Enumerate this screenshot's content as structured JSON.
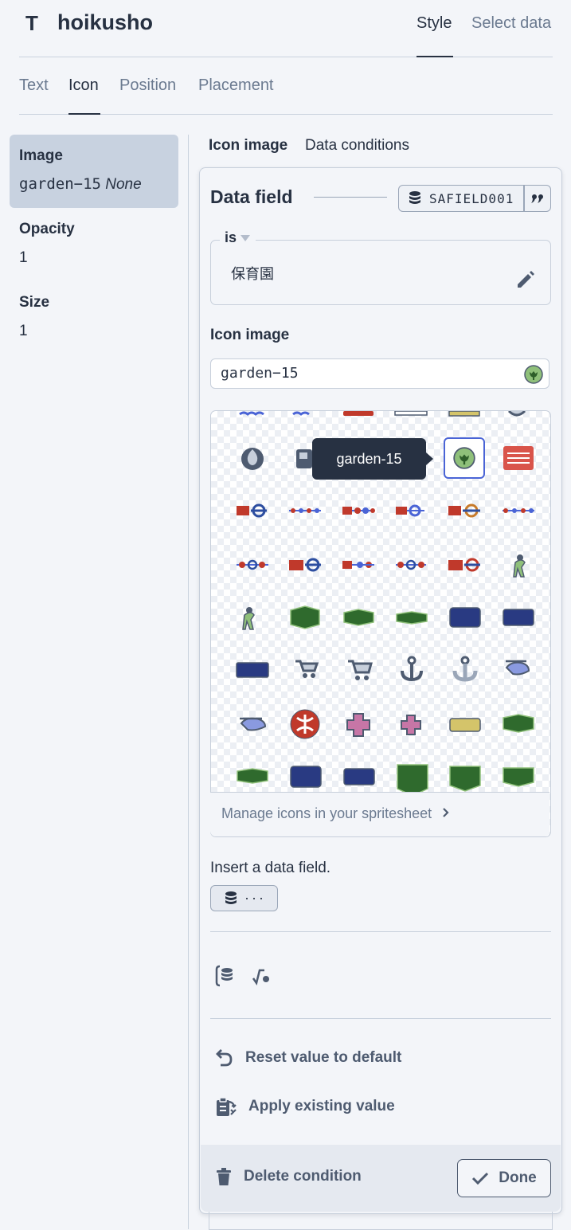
{
  "header": {
    "layer_type_icon": "text-layer-icon",
    "layer_type_glyph": "T",
    "layer_name": "hoikusho",
    "tabs": [
      {
        "label": "Style",
        "active": true
      },
      {
        "label": "Select data",
        "active": false
      }
    ]
  },
  "subtabs": [
    {
      "label": "Text",
      "active": false
    },
    {
      "label": "Icon",
      "active": true
    },
    {
      "label": "Position",
      "active": false
    },
    {
      "label": "Placement",
      "active": false
    }
  ],
  "properties": [
    {
      "label": "Image",
      "value": "garden−15",
      "value_suffix": "None",
      "selected": true
    },
    {
      "label": "Opacity",
      "value": "1"
    },
    {
      "label": "Size",
      "value": "1"
    }
  ],
  "panel_tabs": [
    {
      "label": "Icon image",
      "active": true
    },
    {
      "label": "Data conditions",
      "active": false
    }
  ],
  "condition": {
    "data_field_title": "Data field",
    "field_name": "SAFIELD001",
    "operator": "is",
    "value": "保育園",
    "icon_image_label": "Icon image",
    "icon_image_value": "garden−15",
    "tooltip": "garden-15",
    "manage_link": "Manage icons in your spritesheet",
    "insert_text": "Insert a data field.",
    "insert_chip": "···",
    "actions": {
      "reset": "Reset value to default",
      "apply": "Apply existing value",
      "delete": "Delete condition",
      "done": "Done"
    }
  },
  "colors": {
    "accent": "#4a64d6",
    "text": "#273142",
    "muted": "#6b7a90",
    "tooltip_bg": "#273142"
  }
}
